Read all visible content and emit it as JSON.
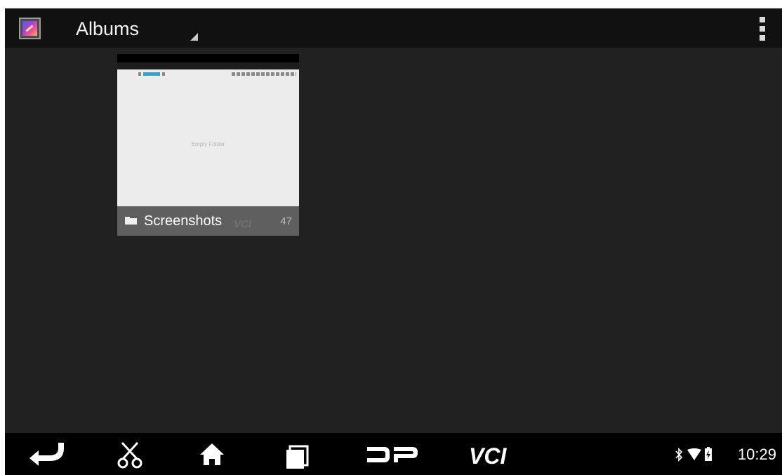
{
  "action_bar": {
    "title": "Albums",
    "app_icon": "gallery-icon",
    "overflow_icon": "overflow-menu-icon"
  },
  "albums": [
    {
      "name": "Screenshots",
      "count": "47",
      "thumbnail_text": "Empty Folder",
      "watermark": "VCI",
      "icon": "folder-icon"
    }
  ],
  "navigation_bar": {
    "buttons": [
      {
        "icon": "back-icon"
      },
      {
        "icon": "scissors-icon"
      },
      {
        "icon": "home-icon"
      },
      {
        "icon": "recent-apps-icon"
      },
      {
        "icon": "dp-logo-icon"
      },
      {
        "icon": "vci-logo-icon"
      }
    ],
    "status": {
      "bluetooth_icon": "bluetooth-icon",
      "wifi_icon": "wifi-icon",
      "battery_icon": "battery-charging-icon",
      "time": "10:29"
    }
  },
  "colors": {
    "background": "#212121",
    "action_bar": "#111111",
    "nav_bar": "#000000",
    "thumb_tab_accent": "#2aa7d8"
  }
}
